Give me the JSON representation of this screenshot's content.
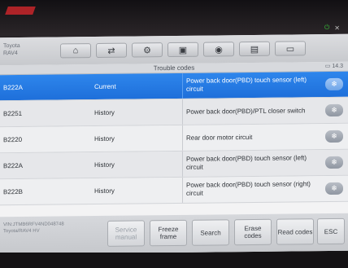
{
  "app": {
    "vehicle_make": "Toyota",
    "vehicle_model": "RAV4"
  },
  "toolbar": {
    "buttons": [
      {
        "icon": "home-icon",
        "glyph": "⌂"
      },
      {
        "icon": "vehicle-swap-icon",
        "glyph": "⇄"
      },
      {
        "icon": "settings-icon",
        "glyph": "⚙"
      },
      {
        "icon": "print-icon",
        "glyph": "▣"
      },
      {
        "icon": "camera-icon",
        "glyph": "◉"
      },
      {
        "icon": "save-icon",
        "glyph": "▤"
      },
      {
        "icon": "message-icon",
        "glyph": "▭"
      }
    ]
  },
  "panel": {
    "title": "Trouble codes",
    "battery": "14.3"
  },
  "codes": [
    {
      "code": "B222A",
      "status": "Current",
      "description": "Power back door(PBD) touch sensor (left) circuit",
      "help_glyph": "❄"
    },
    {
      "code": "B2251",
      "status": "History",
      "description": "Power back door(PBD)/PTL closer switch",
      "help_glyph": "❄"
    },
    {
      "code": "B2220",
      "status": "History",
      "description": "Rear door motor circuit",
      "help_glyph": "❄"
    },
    {
      "code": "B222A",
      "status": "History",
      "description": "Power back door(PBD) touch sensor (left) circuit",
      "help_glyph": "❄"
    },
    {
      "code": "B222B",
      "status": "History",
      "description": "Power back door(PBD) touch sensor (right) circuit",
      "help_glyph": "❄"
    }
  ],
  "footer": {
    "vin_line": "VIN:JTMB6RFV4ND048748",
    "vehicle_line": "Toyota/RAV4 HV",
    "buttons": {
      "service_manual": "Service manual",
      "freeze_frame": "Freeze frame",
      "search": "Search",
      "erase_codes": "Erase codes",
      "read_codes": "Read codes",
      "esc": "ESC"
    }
  },
  "colors": {
    "selected_row": "#1e6fda",
    "status_icon": "#39c23a"
  }
}
